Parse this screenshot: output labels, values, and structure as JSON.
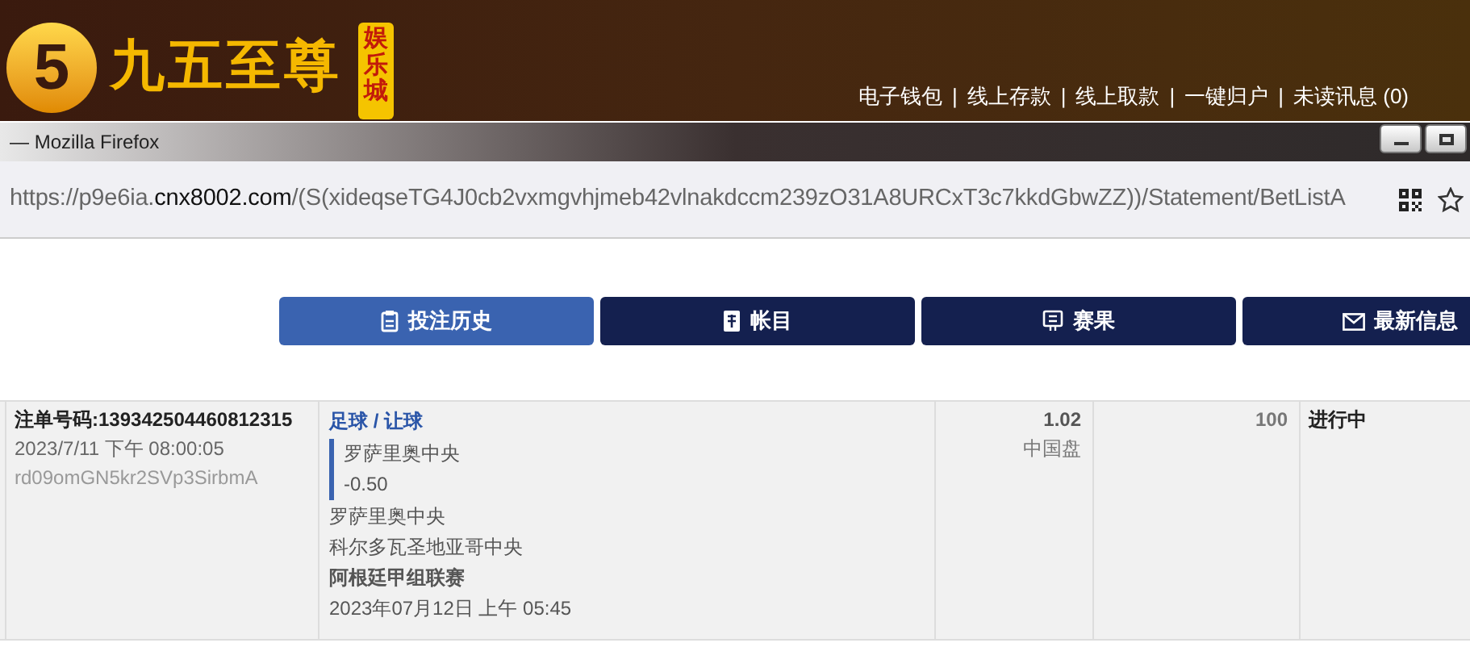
{
  "banner": {
    "logo_mark": "5",
    "logo_text": "九五至尊",
    "logo_badge": "娱乐城",
    "links": [
      "电子钱包",
      "线上存款",
      "线上取款",
      "一键归户",
      "未读讯息 (0)"
    ],
    "separator": "|"
  },
  "browser": {
    "title": "— Mozilla Firefox",
    "url": {
      "scheme_host": "https://p9e6ia.",
      "domain": "cnx8002.com",
      "path": "/(S(xideqseTG4J0cb2vxmgvhjmeb42vlnakdccm239zO31A8URCxT3c7kkdGbwZZ))/Statement/BetListA"
    }
  },
  "tabs": [
    {
      "label": "投注历史",
      "selected": true
    },
    {
      "label": "帐目",
      "selected": false
    },
    {
      "label": "赛果",
      "selected": false
    },
    {
      "label": "最新信息",
      "selected": false
    }
  ],
  "bets": [
    {
      "ticket": "注单号码:139342504460812315",
      "placed": "2023/7/11 下午 08:00:05",
      "code": "rd09omGN5kr2SVp3SirbmA",
      "sport_market": "足球 / 让球",
      "pick": "罗萨里奥中央",
      "handicap": "-0.50",
      "home": "罗萨里奥中央",
      "away": "科尔多瓦圣地亚哥中央",
      "league": "阿根廷甲组联赛",
      "kickoff": "2023年07月12日 上午 05:45",
      "odds": "1.02",
      "odds_type": "中国盘",
      "stake": "100",
      "status": "进行中"
    }
  ]
}
